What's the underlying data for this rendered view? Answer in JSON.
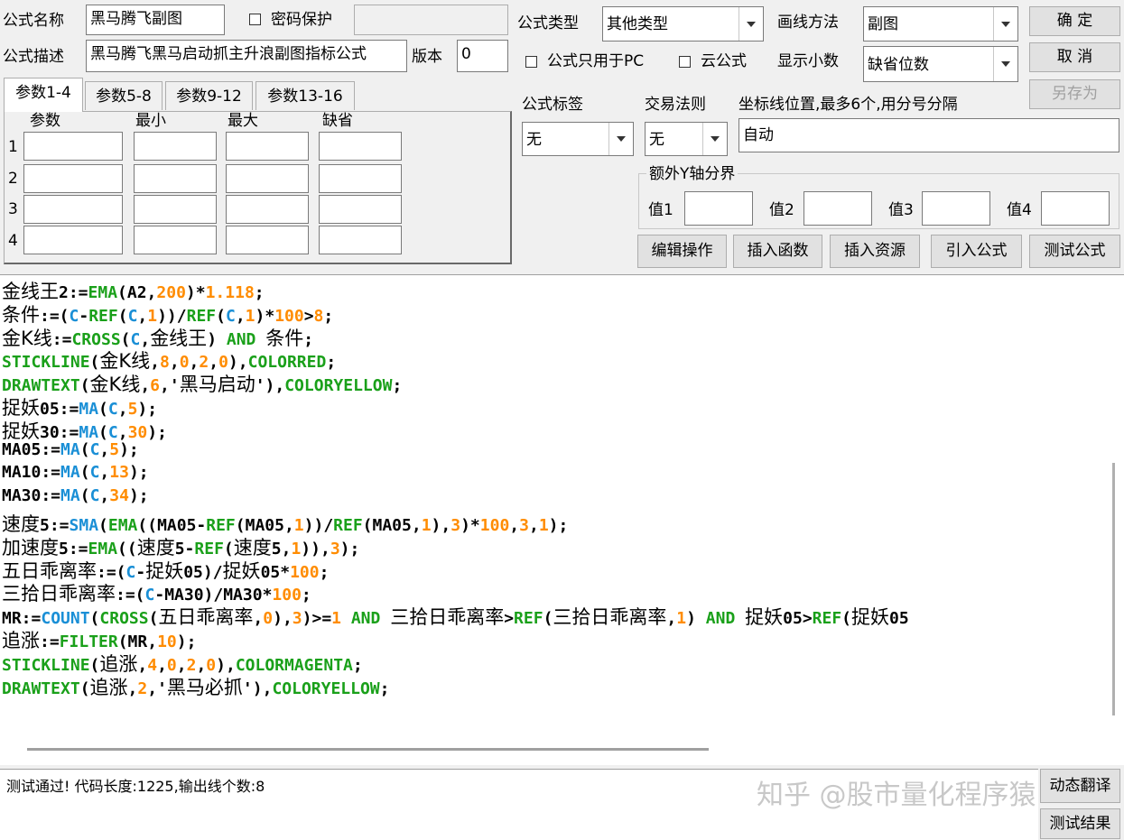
{
  "labels": {
    "formula_name": "公式名称",
    "password_protect": "密码保护",
    "formula_type": "公式类型",
    "draw_method": "画线方法",
    "formula_desc": "公式描述",
    "version": "版本",
    "pc_only": "公式只用于PC",
    "cloud": "云公式",
    "decimals": "显示小数",
    "formula_tag": "公式标签",
    "trade_rule": "交易法则",
    "axis_pos": "坐标线位置,最多6个,用分号分隔",
    "extra_y": "额外Y轴分界",
    "val1": "值1",
    "val2": "值2",
    "val3": "值3",
    "val4": "值4"
  },
  "fields": {
    "formula_name": "黑马腾飞副图",
    "password": "",
    "formula_type": "其他类型",
    "draw_method": "副图",
    "formula_desc": "黑马腾飞黑马启动抓主升浪副图指标公式",
    "version": "0",
    "decimals": "缺省位数",
    "formula_tag": "无",
    "trade_rule": "无",
    "axis_pos": "自动"
  },
  "buttons": {
    "ok": "确 定",
    "cancel": "取 消",
    "save_as": "另存为",
    "edit_ops": "编辑操作",
    "insert_func": "插入函数",
    "insert_res": "插入资源",
    "import_formula": "引入公式",
    "test_formula": "测试公式",
    "dynamic_translate": "动态翻译",
    "test_result": "测试结果"
  },
  "param_tabs": [
    "参数1-4",
    "参数5-8",
    "参数9-12",
    "参数13-16"
  ],
  "param_headers": [
    "参数",
    "最小",
    "最大",
    "缺省"
  ],
  "param_rows": [
    "1",
    "2",
    "3",
    "4"
  ],
  "status": "测试通过! 代码长度:1225,输出线个数:8",
  "watermark": "知乎 @股市量化程序猿",
  "code_lines": [
    [
      [
        "金线王",
        "cn"
      ],
      [
        "2:=",
        ""
      ],
      [
        "EMA",
        "g"
      ],
      [
        "(A2,",
        ""
      ],
      [
        "200",
        "n"
      ],
      [
        ")*",
        ""
      ],
      [
        "1.118",
        "n"
      ],
      [
        ";",
        ""
      ]
    ],
    [
      [
        "条件",
        "cn"
      ],
      [
        ":=(",
        ""
      ],
      [
        "C",
        "f"
      ],
      [
        "-",
        ""
      ],
      [
        "REF",
        "g"
      ],
      [
        "(",
        ""
      ],
      [
        "C",
        "f"
      ],
      [
        ",",
        ""
      ],
      [
        "1",
        "n"
      ],
      [
        "))/",
        ""
      ],
      [
        "REF",
        "g"
      ],
      [
        "(",
        ""
      ],
      [
        "C",
        "f"
      ],
      [
        ",",
        ""
      ],
      [
        "1",
        "n"
      ],
      [
        ")*",
        ""
      ],
      [
        "100",
        "n"
      ],
      [
        ">",
        ""
      ],
      [
        "8",
        "n"
      ],
      [
        ";",
        ""
      ]
    ],
    [
      [
        "金K线",
        "cn"
      ],
      [
        ":=",
        ""
      ],
      [
        "CROSS",
        "g"
      ],
      [
        "(",
        ""
      ],
      [
        "C",
        "f"
      ],
      [
        ",",
        ""
      ],
      [
        "金线王",
        "cn"
      ],
      [
        ") ",
        ""
      ],
      [
        "AND",
        "g"
      ],
      [
        " ",
        ""
      ],
      [
        "条件",
        "cn"
      ],
      [
        ";",
        ""
      ]
    ],
    [
      [
        "STICKLINE",
        "g"
      ],
      [
        "(",
        ""
      ],
      [
        "金K线",
        "cn"
      ],
      [
        ",",
        ""
      ],
      [
        "8",
        "n"
      ],
      [
        ",",
        ""
      ],
      [
        "0",
        "n"
      ],
      [
        ",",
        ""
      ],
      [
        "2",
        "n"
      ],
      [
        ",",
        ""
      ],
      [
        "0",
        "n"
      ],
      [
        "),",
        ""
      ],
      [
        "COLORRED",
        "g"
      ],
      [
        ";",
        ""
      ]
    ],
    [
      [
        "DRAWTEXT",
        "g"
      ],
      [
        "(",
        ""
      ],
      [
        "金K线",
        "cn"
      ],
      [
        ",",
        ""
      ],
      [
        "6",
        "n"
      ],
      [
        ",'",
        ""
      ],
      [
        "黑马启动",
        "cn"
      ],
      [
        "'),",
        ""
      ],
      [
        "COLORYELLOW",
        "g"
      ],
      [
        ";",
        ""
      ]
    ],
    [
      [
        "捉妖",
        "cn"
      ],
      [
        "05:=",
        ""
      ],
      [
        "MA",
        "f"
      ],
      [
        "(",
        ""
      ],
      [
        "C",
        "f"
      ],
      [
        ",",
        ""
      ],
      [
        "5",
        "n"
      ],
      [
        ");",
        ""
      ]
    ],
    [
      [
        "捉妖",
        "cn"
      ],
      [
        "30:=",
        ""
      ],
      [
        "MA",
        "f"
      ],
      [
        "(",
        ""
      ],
      [
        "C",
        "f"
      ],
      [
        ",",
        ""
      ],
      [
        "30",
        "n"
      ],
      [
        ");",
        ""
      ]
    ],
    [
      [
        "MA05:=",
        ""
      ],
      [
        "MA",
        "f"
      ],
      [
        "(",
        ""
      ],
      [
        "C",
        "f"
      ],
      [
        ",",
        ""
      ],
      [
        "5",
        "n"
      ],
      [
        ");",
        ""
      ]
    ],
    [
      [
        "MA10:=",
        ""
      ],
      [
        "MA",
        "f"
      ],
      [
        "(",
        ""
      ],
      [
        "C",
        "f"
      ],
      [
        ",",
        ""
      ],
      [
        "13",
        "n"
      ],
      [
        ");",
        ""
      ]
    ],
    [
      [
        "MA30:=",
        ""
      ],
      [
        "MA",
        "f"
      ],
      [
        "(",
        ""
      ],
      [
        "C",
        "f"
      ],
      [
        ",",
        ""
      ],
      [
        "34",
        "n"
      ],
      [
        ");",
        ""
      ]
    ],
    [
      [
        "速度",
        "cn"
      ],
      [
        "5:=",
        ""
      ],
      [
        "SMA",
        "f"
      ],
      [
        "(",
        ""
      ],
      [
        "EMA",
        "g"
      ],
      [
        "((MA05-",
        ""
      ],
      [
        "REF",
        "g"
      ],
      [
        "(MA05,",
        ""
      ],
      [
        "1",
        "n"
      ],
      [
        "))/",
        ""
      ],
      [
        "REF",
        "g"
      ],
      [
        "(MA05,",
        ""
      ],
      [
        "1",
        "n"
      ],
      [
        "),",
        ""
      ],
      [
        "3",
        "n"
      ],
      [
        ")*",
        ""
      ],
      [
        "100",
        "n"
      ],
      [
        ",",
        ""
      ],
      [
        "3",
        "n"
      ],
      [
        ",",
        ""
      ],
      [
        "1",
        "n"
      ],
      [
        ");",
        ""
      ]
    ],
    [
      [
        "加速度",
        "cn"
      ],
      [
        "5:=",
        ""
      ],
      [
        "EMA",
        "g"
      ],
      [
        "((",
        ""
      ],
      [
        "速度",
        "cn"
      ],
      [
        "5-",
        ""
      ],
      [
        "REF",
        "g"
      ],
      [
        "(",
        ""
      ],
      [
        "速度",
        "cn"
      ],
      [
        "5,",
        ""
      ],
      [
        "1",
        "n"
      ],
      [
        ")),",
        ""
      ],
      [
        "3",
        "n"
      ],
      [
        ");",
        ""
      ]
    ],
    [
      [
        "五日乖离率",
        "cn"
      ],
      [
        ":=(",
        ""
      ],
      [
        "C",
        "f"
      ],
      [
        "-",
        ""
      ],
      [
        "捉妖",
        "cn"
      ],
      [
        "05)/",
        ""
      ],
      [
        "捉妖",
        "cn"
      ],
      [
        "05*",
        ""
      ],
      [
        "100",
        "n"
      ],
      [
        ";",
        ""
      ]
    ],
    [
      [
        "三拾日乖离率",
        "cn"
      ],
      [
        ":=(",
        ""
      ],
      [
        "C",
        "f"
      ],
      [
        "-MA30)/MA30*",
        ""
      ],
      [
        "100",
        "n"
      ],
      [
        ";",
        ""
      ]
    ],
    [
      [
        "MR:=",
        ""
      ],
      [
        "COUNT",
        "f"
      ],
      [
        "(",
        ""
      ],
      [
        "CROSS",
        "g"
      ],
      [
        "(",
        ""
      ],
      [
        "五日乖离率",
        "cn"
      ],
      [
        ",",
        ""
      ],
      [
        "0",
        "n"
      ],
      [
        "),",
        ""
      ],
      [
        "3",
        "n"
      ],
      [
        ")>=",
        ""
      ],
      [
        "1",
        "n"
      ],
      [
        " ",
        ""
      ],
      [
        "AND",
        "g"
      ],
      [
        " ",
        ""
      ],
      [
        "三拾日乖离率",
        "cn"
      ],
      [
        ">",
        ""
      ],
      [
        "REF",
        "g"
      ],
      [
        "(",
        ""
      ],
      [
        "三拾日乖离率",
        "cn"
      ],
      [
        ",",
        ""
      ],
      [
        "1",
        "n"
      ],
      [
        ") ",
        ""
      ],
      [
        "AND",
        "g"
      ],
      [
        " ",
        ""
      ],
      [
        "捉妖",
        "cn"
      ],
      [
        "05>",
        ""
      ],
      [
        "REF",
        "g"
      ],
      [
        "(",
        ""
      ],
      [
        "捉妖",
        "cn"
      ],
      [
        "05",
        ""
      ]
    ],
    [
      [
        "追涨",
        "cn"
      ],
      [
        ":=",
        ""
      ],
      [
        "FILTER",
        "g"
      ],
      [
        "(MR,",
        ""
      ],
      [
        "10",
        "n"
      ],
      [
        ");",
        ""
      ]
    ],
    [
      [
        "STICKLINE",
        "g"
      ],
      [
        "(",
        ""
      ],
      [
        "追涨",
        "cn"
      ],
      [
        ",",
        ""
      ],
      [
        "4",
        "n"
      ],
      [
        ",",
        ""
      ],
      [
        "0",
        "n"
      ],
      [
        ",",
        ""
      ],
      [
        "2",
        "n"
      ],
      [
        ",",
        ""
      ],
      [
        "0",
        "n"
      ],
      [
        "),",
        ""
      ],
      [
        "COLORMAGENTA",
        "g"
      ],
      [
        ";",
        ""
      ]
    ],
    [
      [
        "DRAWTEXT",
        "g"
      ],
      [
        "(",
        ""
      ],
      [
        "追涨",
        "cn"
      ],
      [
        ",",
        ""
      ],
      [
        "2",
        "n"
      ],
      [
        ",'",
        ""
      ],
      [
        "黑马必抓",
        "cn"
      ],
      [
        "'),",
        ""
      ],
      [
        "COLORYELLOW",
        "g"
      ],
      [
        ";",
        ""
      ]
    ]
  ]
}
